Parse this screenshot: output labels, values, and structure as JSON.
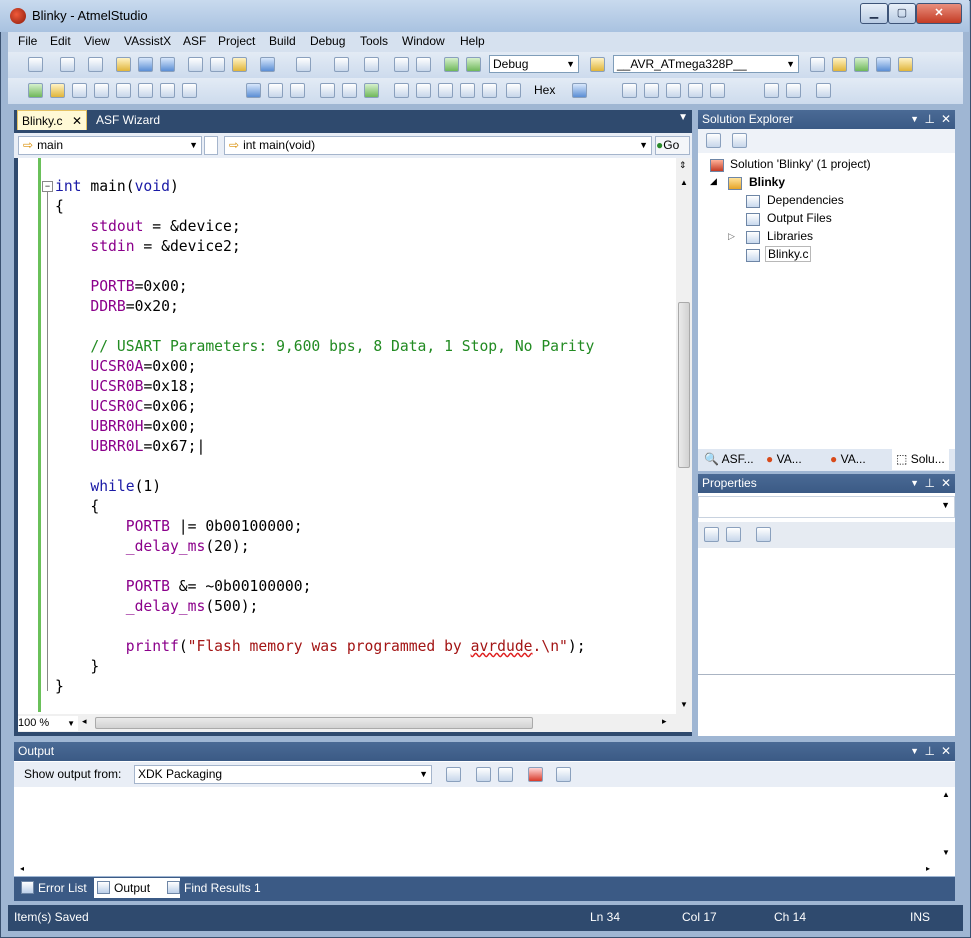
{
  "window": {
    "title": "Blinky - AtmelStudio"
  },
  "menu": [
    "File",
    "Edit",
    "View",
    "VAssistX",
    "ASF",
    "Project",
    "Build",
    "Debug",
    "Tools",
    "Window",
    "Help"
  ],
  "toolbar": {
    "config": "Debug",
    "device": "__AVR_ATmega328P__",
    "hex_label": "Hex"
  },
  "editor": {
    "tabs": [
      "Blinky.c",
      "ASF Wizard"
    ],
    "nav_left": "main",
    "nav_right": "int main(void)",
    "go_label": "Go",
    "zoom": "100 %",
    "code": [
      "int main(void)",
      "{",
      "    stdout = &device;",
      "    stdin = &device2;",
      "",
      "    PORTB=0x00;",
      "    DDRB=0x20;",
      "",
      "    // USART Parameters: 9,600 bps, 8 Data, 1 Stop, No Parity",
      "    UCSR0A=0x00;",
      "    UCSR0B=0x18;",
      "    UCSR0C=0x06;",
      "    UBRR0H=0x00;",
      "    UBRR0L=0x67;",
      "",
      "    while(1)",
      "    {",
      "        PORTB |= 0b00100000;",
      "        _delay_ms(20);",
      "",
      "        PORTB &= ~0b00100000;",
      "        _delay_ms(500);",
      "",
      "        printf(\"Flash memory was programmed by avrdude.\\n\");",
      "    }",
      "}"
    ]
  },
  "solution_explorer": {
    "title": "Solution Explorer",
    "solution": "Solution 'Blinky' (1 project)",
    "project": "Blinky",
    "items": [
      "Dependencies",
      "Output Files",
      "Libraries",
      "Blinky.c"
    ],
    "tabs": [
      "ASF...",
      "VA...",
      "VA...",
      "Solu..."
    ]
  },
  "properties": {
    "title": "Properties"
  },
  "output": {
    "title": "Output",
    "show_label": "Show output from:",
    "source": "XDK Packaging"
  },
  "bottom_tabs": [
    "Error List",
    "Output",
    "Find Results 1"
  ],
  "status": {
    "message": "Item(s) Saved",
    "ln": "Ln 34",
    "col": "Col 17",
    "ch": "Ch 14",
    "mode": "INS"
  }
}
